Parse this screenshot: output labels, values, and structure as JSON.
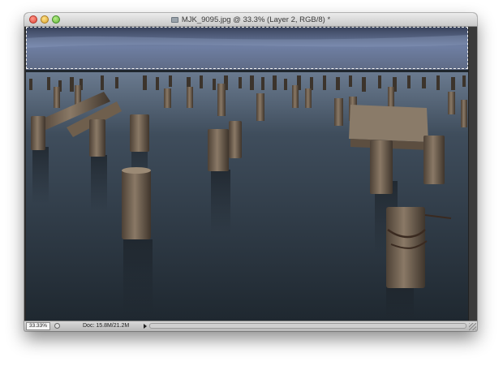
{
  "window": {
    "title": "MJK_9095.jpg @ 33.3% (Layer 2, RGB/8) *"
  },
  "statusbar": {
    "zoom": "33.33%",
    "doc_info": "Doc: 15.8M/21.2M"
  },
  "canvas": {
    "subject": "long exposure of old wooden pier pilings in calm water under cloudy sky",
    "selection": "marquee selection around sky"
  },
  "colors": {
    "sky_top": "#3f4a63",
    "sky_mid": "#6d7c9e",
    "water": "#2f3a46",
    "wood": "#6b5a48",
    "titlebar": "#d4d4d4"
  }
}
